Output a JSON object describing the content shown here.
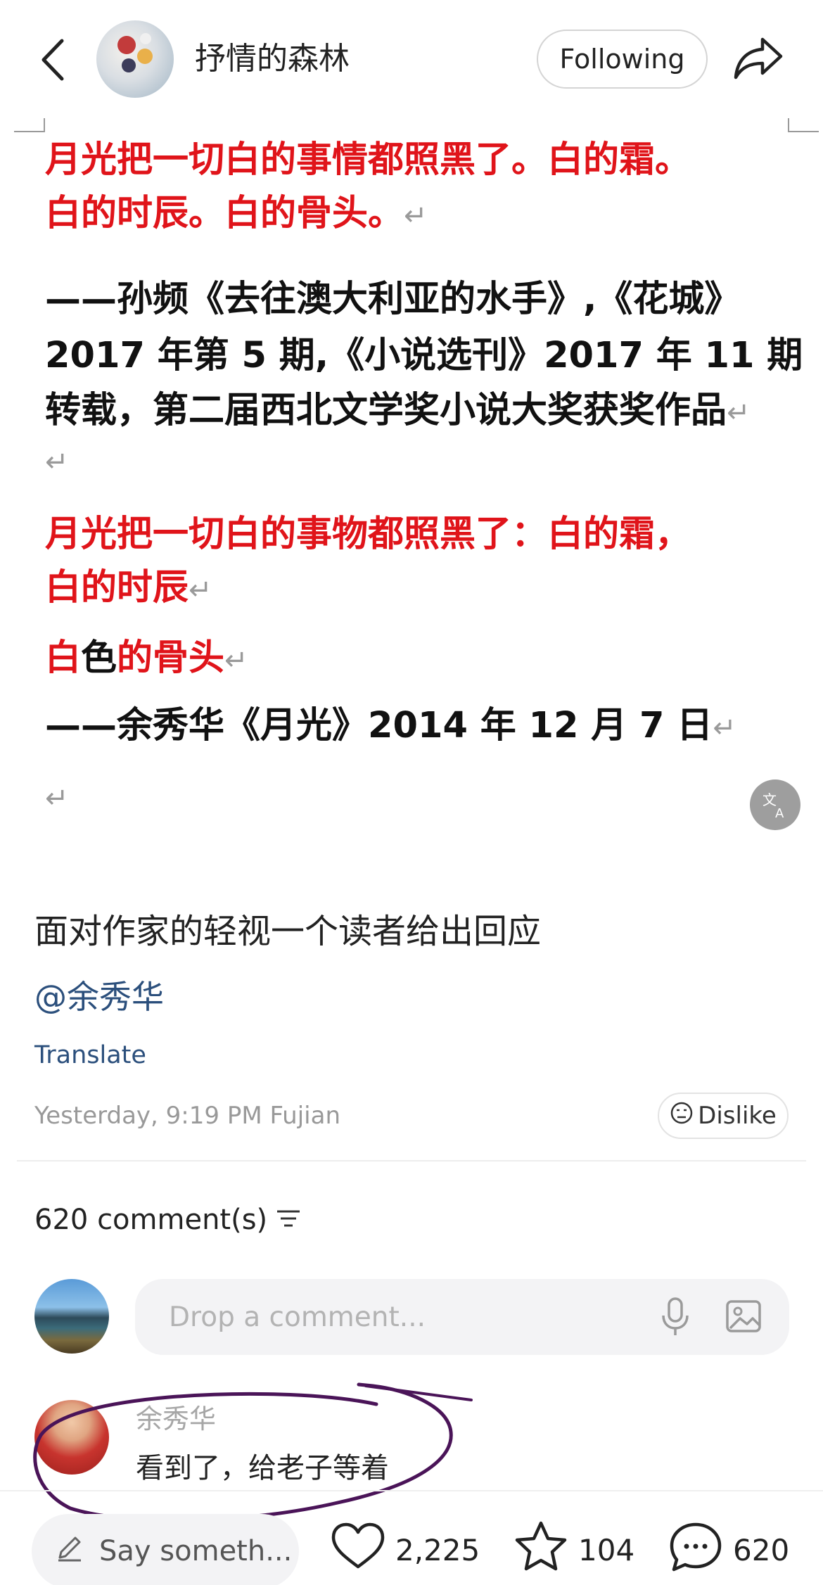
{
  "header": {
    "author_name": "抒情的森林",
    "follow_label": "Following"
  },
  "document": {
    "quote1_line1": "月光把一切白的事情都照黑了。白的霜。",
    "quote1_line2": "白的时辰。白的骨头。",
    "source1_line1": "——孙频《去往澳大利亚的水手》,《花城》",
    "source1_line2": "2017 年第 5 期,《小说选刊》2017 年 11 期",
    "source1_line3": "转载，第二届西北文学奖小说大奖获奖作品",
    "quote2_line1": "月光把一切白的事物都照黑了：白的霜，",
    "quote2_line2": "白的时辰",
    "quote2_line3_a": "白",
    "quote2_line3_b": "色",
    "quote2_line3_c": "的骨头",
    "source2": "——余秀华《月光》2014 年 12 月 7 日",
    "return_mark": "↵"
  },
  "post": {
    "title": "面对作家的轻视一个读者给出回应",
    "mention": "@余秀华",
    "translate_label": "Translate",
    "meta": "Yesterday, 9:19 PM Fujian",
    "dislike_label": "Dislike"
  },
  "comments": {
    "count_label": "620 comment(s)",
    "input_placeholder": "Drop a comment...",
    "items": [
      {
        "name": "余秀华",
        "text": "看到了，给老子等着"
      }
    ]
  },
  "bottom_bar": {
    "say_placeholder": "Say someth...",
    "likes": "2,225",
    "favorites": "104",
    "comments": "620"
  },
  "colors": {
    "quote_red": "#e0141a",
    "link_blue": "#2b4f7c",
    "annotation_purple": "#4a1458"
  }
}
